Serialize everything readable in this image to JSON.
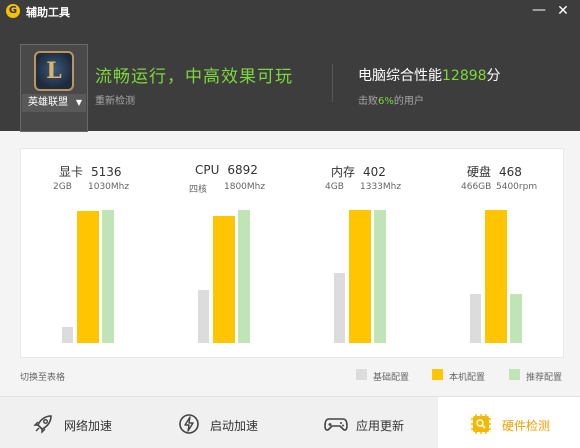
{
  "titlebar": {
    "title": "辅助工具",
    "logo_glyph": "G",
    "minimize_glyph": "—",
    "close_glyph": "✕"
  },
  "header": {
    "game": {
      "name": "英雄联盟",
      "icon_letter": "L"
    },
    "status": "流畅运行，中高效果可玩",
    "recheck": "重新检测",
    "score": {
      "prefix": "电脑综合性能",
      "value": "12898",
      "unit": "分"
    },
    "beat": {
      "prefix": "击败",
      "percent": "6%",
      "suffix": "的用户"
    }
  },
  "metrics": [
    {
      "name": "显卡",
      "score": "5136",
      "sub1": "2GB",
      "sub2": "1030Mhz",
      "basic": 0.12,
      "current": 1.0,
      "recommend": 1.01
    },
    {
      "name": "CPU",
      "score": "6892",
      "sub1": "四核",
      "sub2": "1800Mhz",
      "basic": 0.4,
      "current": 0.96,
      "recommend": 1.01
    },
    {
      "name": "内存",
      "score": "402",
      "sub1": "4GB",
      "sub2": "1333Mhz",
      "basic": 0.53,
      "current": 1.01,
      "recommend": 1.01
    },
    {
      "name": "硬盘",
      "score": "468",
      "sub1": "466GB",
      "sub2": "5400rpm",
      "basic": 0.37,
      "current": 1.01,
      "recommend": 0.37
    }
  ],
  "legend": {
    "switch": "切换至表格",
    "basic": "基础配置",
    "current": "本机配置",
    "recommend": "推荐配置"
  },
  "colors": {
    "basic": "#dcdcdc",
    "current": "#ffc500",
    "recommend": "#c1e4b6",
    "accent_green": "#7bd83c",
    "accent_orange": "#f0a000"
  },
  "nav": {
    "network": "网络加速",
    "startup": "启动加速",
    "app_update": "应用更新",
    "hardware": "硬件检测"
  }
}
